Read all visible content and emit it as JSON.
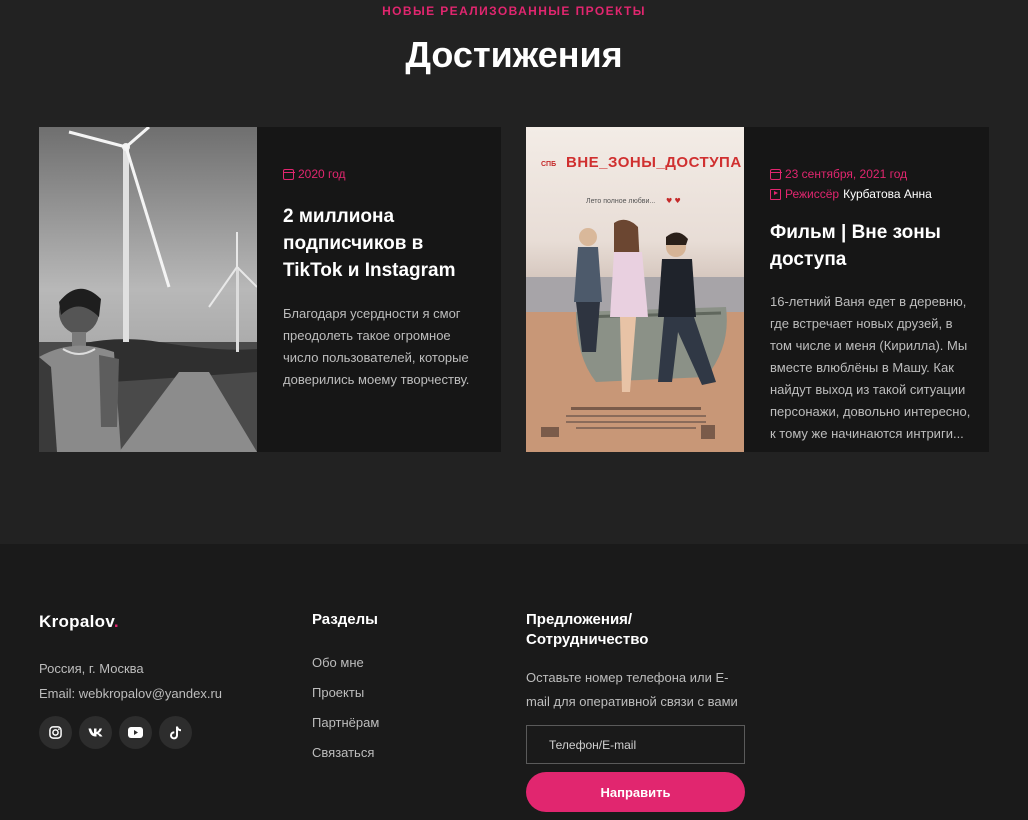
{
  "section": {
    "eyebrow": "НОВЫЕ РЕАЛИЗОВАННЫЕ ПРОЕКТЫ",
    "title": "Достижения"
  },
  "cards": [
    {
      "date": "2020 год",
      "title": "2 миллиона подписчиков в TikTok и Instagram",
      "text": "Благодаря усердности я смог преодолеть такое огромное число пользователей, которые доверились моему творчеству."
    },
    {
      "date": "23 сентября, 2021 год",
      "director_label": "Режиссёр",
      "director_name": "Курбатова Анна",
      "title": "Фильм | Вне зоны доступа",
      "text": "16-летний Ваня едет в деревню, где встречает новых друзей, в том числе и меня (Кирилла). Мы вместе влюблёны в Машу. Как найдут выход из такой ситуации персонажи, довольно интересно, к тому же начинаются интриги...",
      "poster_title": "ВНЕ_ЗОНЫ_ДОСТУПА",
      "poster_tagline": "Лето полное любви...",
      "poster_logo": "СПБ"
    }
  ],
  "footer": {
    "logo": "Kropalov",
    "logo_dot": ".",
    "address": "Россия, г. Москва",
    "email": "Email: webkropalov@yandex.ru",
    "socials": [
      "instagram-icon",
      "vk-icon",
      "youtube-icon",
      "tiktok-icon"
    ],
    "sections_title": "Разделы",
    "links": [
      "Обо мне",
      "Проекты",
      "Партнёрам",
      "Связаться"
    ],
    "offers_title_1": "Предложения/",
    "offers_title_2": "Сотрудничество",
    "offers_text": "Оставьте номер телефона или E-mail для оперативной связи с вами",
    "input_placeholder": "Телефон/E-mail",
    "button": "Направить"
  },
  "colors": {
    "accent": "#e1266f",
    "background": "#222222",
    "footer": "#1a1a1a",
    "card": "#161616"
  }
}
